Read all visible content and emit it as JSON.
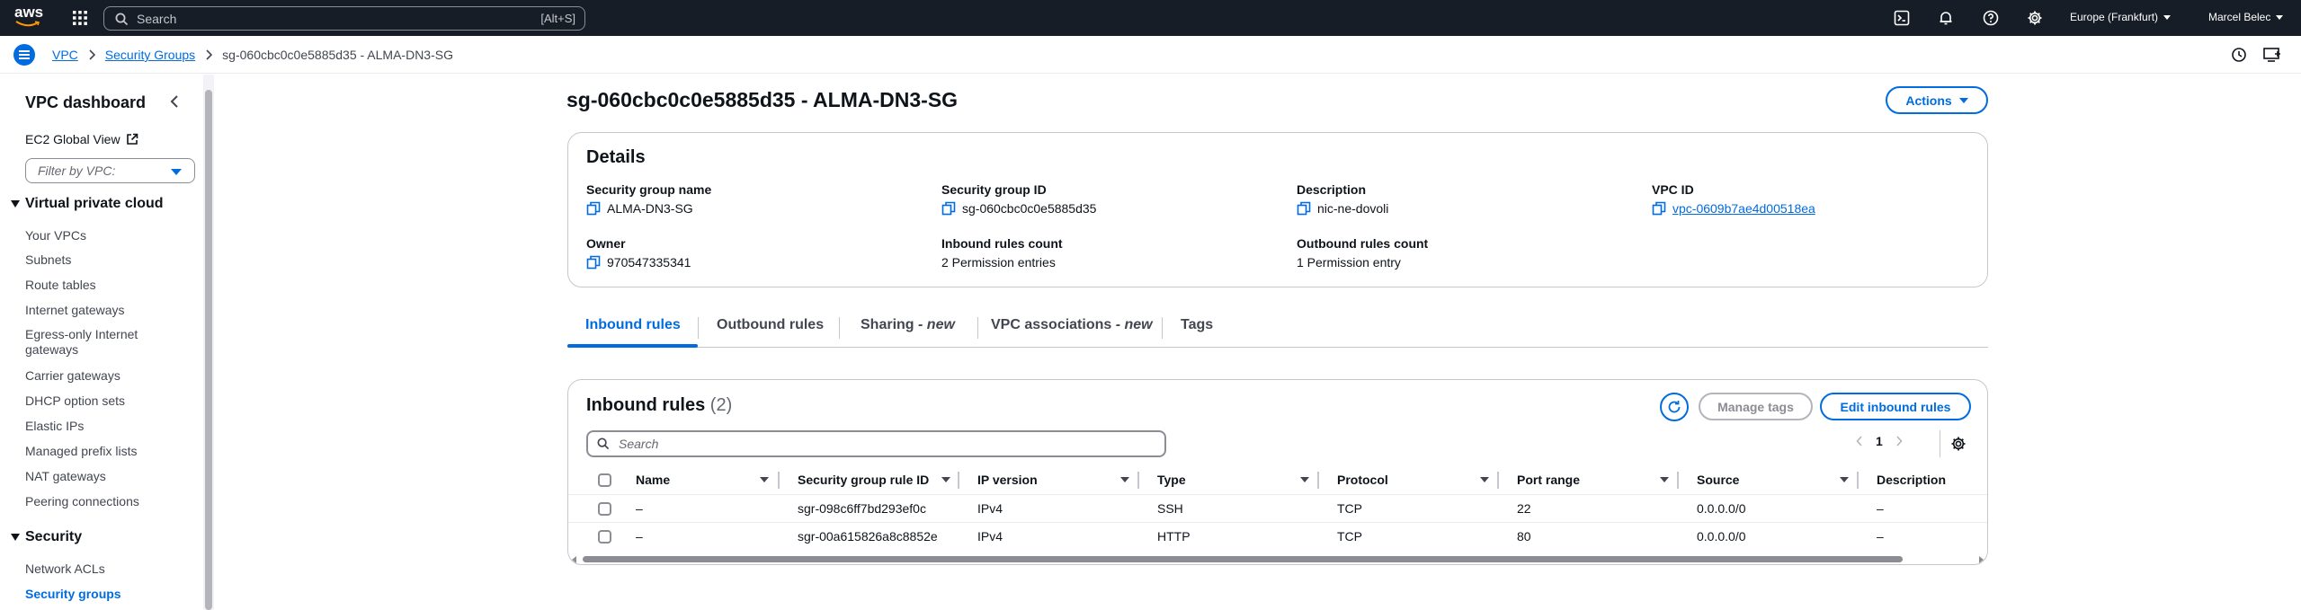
{
  "topnav": {
    "logo": "aws",
    "search_placeholder": "Search",
    "search_shortcut": "[Alt+S]",
    "region": "Europe (Frankfurt)",
    "user": "Marcel Belec",
    "icons": [
      "cloudshell-icon",
      "bell-icon",
      "help-icon",
      "gear-icon"
    ]
  },
  "breadcrumb": {
    "items": [
      "VPC",
      "Security Groups"
    ],
    "current": "sg-060cbc0c0e5885d35 - ALMA-DN3-SG"
  },
  "sidebar": {
    "title": "VPC dashboard",
    "ec2_global_view": "EC2 Global View",
    "filter_placeholder": "Filter by VPC:",
    "section_vpc": "Virtual private cloud",
    "vpc_items": [
      "Your VPCs",
      "Subnets",
      "Route tables",
      "Internet gateways",
      "Egress-only Internet gateways",
      "Carrier gateways",
      "DHCP option sets",
      "Elastic IPs",
      "Managed prefix lists",
      "NAT gateways",
      "Peering connections"
    ],
    "section_security": "Security",
    "security_items": [
      "Network ACLs",
      "Security groups"
    ]
  },
  "page": {
    "title": "sg-060cbc0c0e5885d35 - ALMA-DN3-SG",
    "actions_label": "Actions"
  },
  "details": {
    "title": "Details",
    "sg_name_label": "Security group name",
    "sg_name": "ALMA-DN3-SG",
    "sg_id_label": "Security group ID",
    "sg_id": "sg-060cbc0c0e5885d35",
    "description_label": "Description",
    "description": "nic-ne-dovoli",
    "vpc_id_label": "VPC ID",
    "vpc_id": "vpc-0609b7ae4d00518ea",
    "owner_label": "Owner",
    "owner": "970547335341",
    "inbound_count_label": "Inbound rules count",
    "inbound_count": "2 Permission entries",
    "outbound_count_label": "Outbound rules count",
    "outbound_count": "1 Permission entry"
  },
  "tabs": {
    "inbound": "Inbound rules",
    "outbound": "Outbound rules",
    "sharing": "Sharing",
    "sharing_new": "- new",
    "vpc_assoc": "VPC associations",
    "vpc_assoc_new": "- new",
    "tags": "Tags"
  },
  "rules": {
    "title": "Inbound rules",
    "count": "(2)",
    "manage_tags": "Manage tags",
    "edit_inbound": "Edit inbound rules",
    "search_placeholder": "Search",
    "page": "1",
    "columns": [
      "Name",
      "Security group rule ID",
      "IP version",
      "Type",
      "Protocol",
      "Port range",
      "Source",
      "Description"
    ],
    "rows": [
      {
        "name": "–",
        "rule_id": "sgr-098c6ff7bd293ef0c",
        "ip": "IPv4",
        "type": "SSH",
        "protocol": "TCP",
        "port": "22",
        "source": "0.0.0.0/0",
        "desc": "–"
      },
      {
        "name": "–",
        "rule_id": "sgr-00a615826a8c8852e",
        "ip": "IPv4",
        "type": "HTTP",
        "protocol": "TCP",
        "port": "80",
        "source": "0.0.0.0/0",
        "desc": "–"
      }
    ]
  },
  "colors": {
    "nav_bg": "#161d26",
    "accent": "#006ce0",
    "border": "#c6c6cd"
  }
}
